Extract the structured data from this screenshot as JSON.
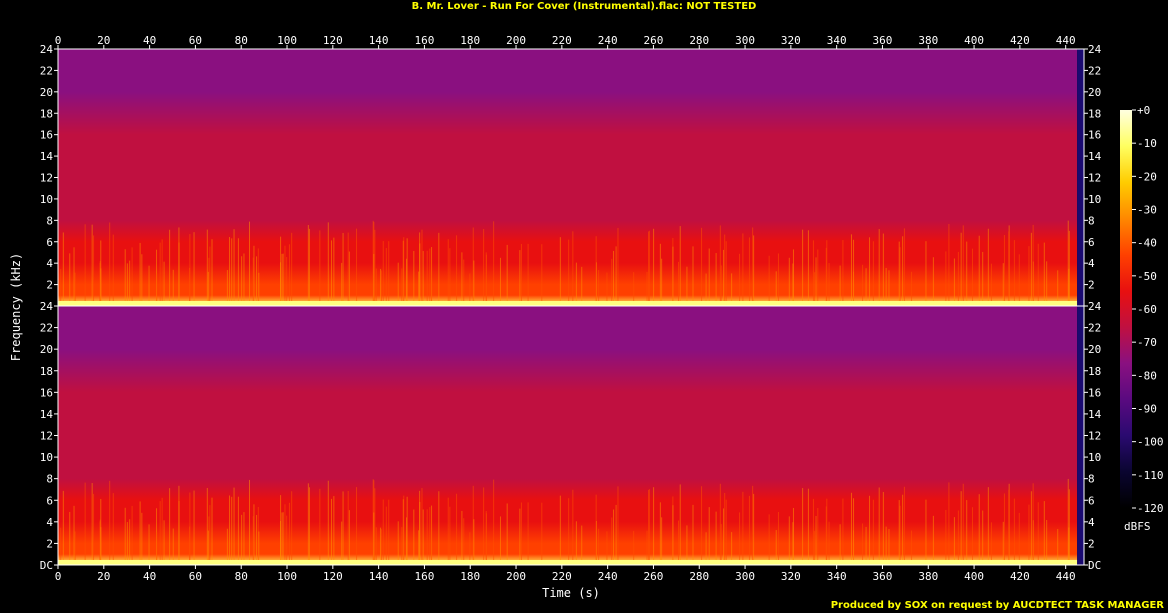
{
  "title": "B. Mr. Lover - Run For Cover (Instrumental).flac: NOT TESTED",
  "footer": "Produced by SOX on request by AUCDTECT TASK MANAGER",
  "chart_data": {
    "type": "heatmap",
    "title": "B. Mr. Lover - Run For Cover (Instrumental).flac: NOT TESTED",
    "xlabel": "Time (s)",
    "ylabel": "Frequency (kHz)",
    "xlim": [
      0,
      448
    ],
    "ylim": [
      0,
      24
    ],
    "x_ticks": [
      "0",
      "20",
      "40",
      "60",
      "80",
      "100",
      "120",
      "140",
      "160",
      "180",
      "200",
      "220",
      "240",
      "260",
      "280",
      "300",
      "320",
      "340",
      "360",
      "380",
      "400",
      "420",
      "440"
    ],
    "y_ticks_upper": [
      "2",
      "4",
      "6",
      "8",
      "10",
      "12",
      "14",
      "16",
      "18",
      "20",
      "22",
      "24"
    ],
    "y_ticks_lower": [
      "DC",
      "2",
      "4",
      "6",
      "8",
      "10",
      "12",
      "14",
      "16",
      "18",
      "20",
      "22",
      "24"
    ],
    "channels": 2,
    "colorbar": {
      "unit": "dBFS",
      "ticks": [
        "+0",
        "-10",
        "-20",
        "-30",
        "-40",
        "-50",
        "-60",
        "-70",
        "-80",
        "-90",
        "-100",
        "-110",
        "-120"
      ],
      "range": [
        -120,
        0
      ],
      "colors": [
        "#000000",
        "#0a0530",
        "#2a0a70",
        "#5a0a80",
        "#8a1080",
        "#c01040",
        "#e81010",
        "#ff4000",
        "#ff8800",
        "#ffcc00",
        "#ffff60",
        "#ffffe0"
      ]
    },
    "spectrum_profile_khz_dbfs": [
      [
        0,
        -15
      ],
      [
        1,
        -40
      ],
      [
        2,
        -45
      ],
      [
        4,
        -50
      ],
      [
        6,
        -58
      ],
      [
        8,
        -63
      ],
      [
        12,
        -67
      ],
      [
        16,
        -70
      ],
      [
        20,
        -75
      ],
      [
        24,
        -80
      ]
    ],
    "end_of_track_s": 445
  }
}
